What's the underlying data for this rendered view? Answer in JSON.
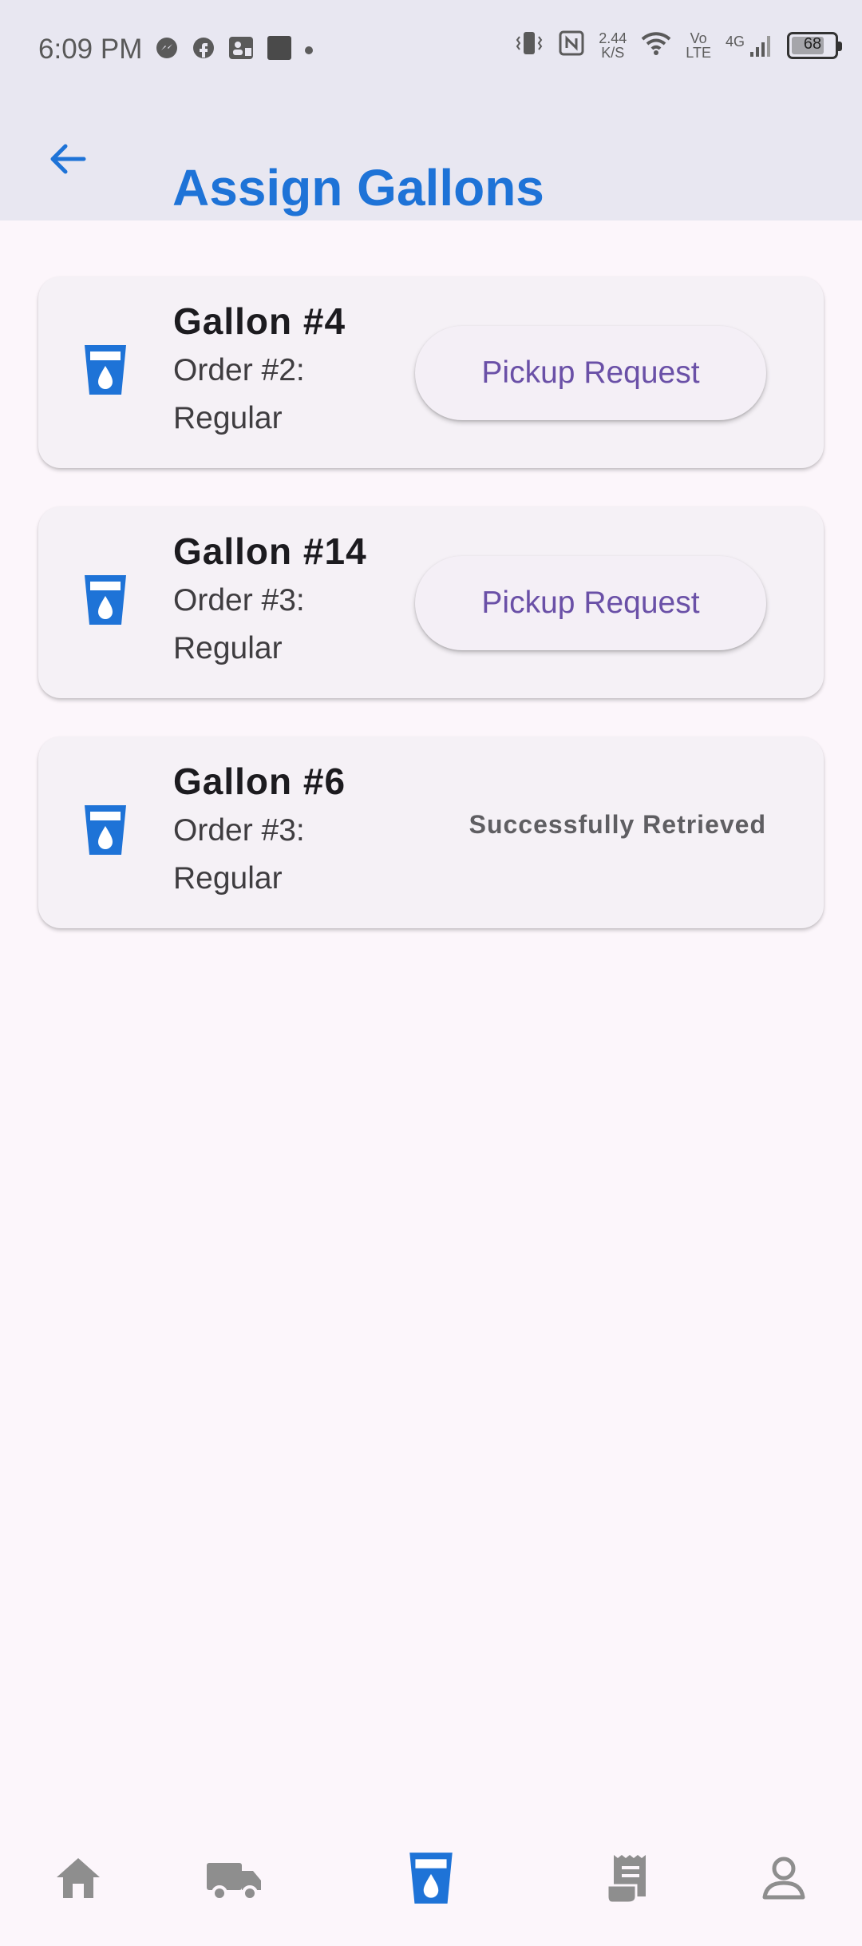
{
  "status_bar": {
    "time": "6:09 PM",
    "network_speed_value": "2.44",
    "network_speed_unit": "K/S",
    "volte_top": "Vo",
    "volte_bottom": "LTE",
    "network_type": "4G",
    "battery": "68"
  },
  "app_bar": {
    "title": "Assign Gallons",
    "back_icon": "back-arrow-icon"
  },
  "gallons": [
    {
      "title": "Gallon #4",
      "order_line1": "Order #2:",
      "order_line2": "Regular",
      "action": "Pickup Request"
    },
    {
      "title": "Gallon #14",
      "order_line1": "Order #3:",
      "order_line2": "Regular",
      "action": "Pickup Request"
    },
    {
      "title": "Gallon #6",
      "order_line1": "Order #3:",
      "order_line2": "Regular",
      "status": "Successfully Retrieved"
    }
  ],
  "bottom_nav": {
    "items": [
      "home-icon",
      "delivery-truck-icon",
      "gallon-icon",
      "receipt-icon",
      "profile-icon"
    ],
    "active_item": "gallon-icon"
  },
  "colors": {
    "accent": "#1e73d7",
    "button_text": "#6a50a7",
    "background": "#fcf6fb",
    "app_bar": "#e8e7f1"
  }
}
